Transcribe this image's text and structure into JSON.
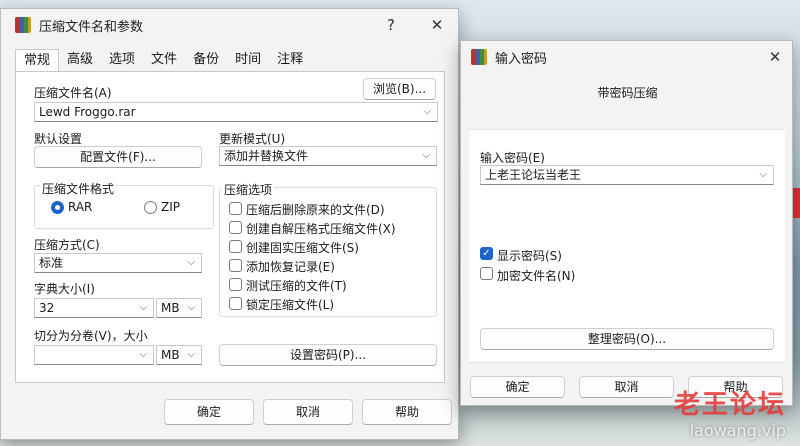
{
  "main": {
    "title": "压缩文件名和参数",
    "help_btn": "?",
    "close_btn": "✕",
    "tabs": [
      "常规",
      "高级",
      "选项",
      "文件",
      "备份",
      "时间",
      "注释"
    ],
    "archive_name_label": "压缩文件名(A)",
    "browse_label": "浏览(B)...",
    "archive_name_value": "Lewd Froggo.rar",
    "default_settings_label": "默认设置",
    "profiles_label": "配置文件(F)...",
    "update_mode_label": "更新模式(U)",
    "update_mode_value": "添加并替换文件",
    "format_group_label": "压缩文件格式",
    "format_rar": "RAR",
    "format_zip": "ZIP",
    "options_group_label": "压缩选项",
    "options": [
      "压缩后删除原来的文件(D)",
      "创建自解压格式压缩文件(X)",
      "创建固实压缩文件(S)",
      "添加恢复记录(E)",
      "测试压缩的文件(T)",
      "锁定压缩文件(L)"
    ],
    "method_label": "压缩方式(C)",
    "method_value": "标准",
    "dict_label": "字典大小(I)",
    "dict_value": "32",
    "dict_unit": "MB",
    "split_label": "切分为分卷(V)，大小",
    "split_value": "",
    "split_unit": "MB",
    "set_password_label": "设置密码(P)...",
    "ok": "确定",
    "cancel": "取消",
    "help": "帮助"
  },
  "pwd": {
    "title": "输入密码",
    "close_btn": "✕",
    "heading": "带密码压缩",
    "enter_label": "输入密码(E)",
    "enter_value": "上老王论坛当老王",
    "show_password": "显示密码(S)",
    "encrypt_names": "加密文件名(N)",
    "organize": "整理密码(O)...",
    "ok": "确定",
    "cancel": "取消",
    "help": "帮助"
  },
  "watermark": {
    "line1": "老王论坛",
    "line2": "laowang.vip"
  }
}
